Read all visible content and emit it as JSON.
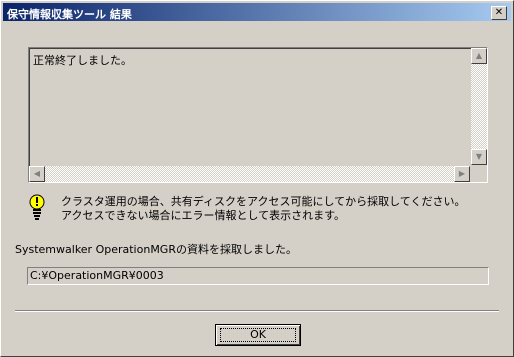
{
  "window": {
    "title": "保守情報収集ツール 結果",
    "close_glyph": "✕"
  },
  "log": {
    "text": "正常終了しました。"
  },
  "warning": {
    "line1": "クラスタ運用の場合、共有ディスクをアクセス可能にしてから採取してください。",
    "line2": "アクセスできない場合にエラー情報として表示されます。"
  },
  "result": {
    "message": "Systemwalker OperationMGRの資料を採取しました。"
  },
  "path": {
    "value": "C:¥OperationMGR¥0003"
  },
  "buttons": {
    "ok": "OK"
  },
  "icons": {
    "warning": "lightbulb-warning-icon"
  },
  "colors": {
    "title_start": "#0a246a",
    "title_end": "#a6caf0",
    "face": "#d4d0c8"
  }
}
